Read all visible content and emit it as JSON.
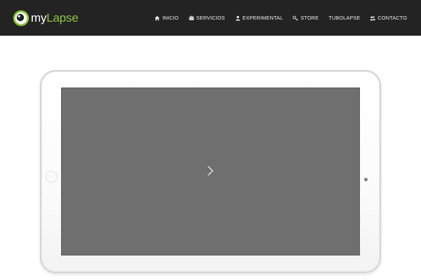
{
  "brand": {
    "my": "my",
    "lapse": "Lapse",
    "accent": "#8cc63f"
  },
  "nav": {
    "items": [
      {
        "label": "INICIO",
        "icon": "home-icon"
      },
      {
        "label": "SERVICIOS",
        "icon": "briefcase-icon"
      },
      {
        "label": "EXPERIMENTAL",
        "icon": "user-icon"
      },
      {
        "label": "STORE",
        "icon": "key-icon"
      },
      {
        "label": "TUBOLAPSE",
        "icon": ""
      },
      {
        "label": "CONTACTO",
        "icon": "users-icon"
      }
    ]
  },
  "slider": {
    "next_icon": "chevron-right-icon"
  },
  "colors": {
    "navbar": "#232323",
    "screen": "#6f6f6f"
  }
}
